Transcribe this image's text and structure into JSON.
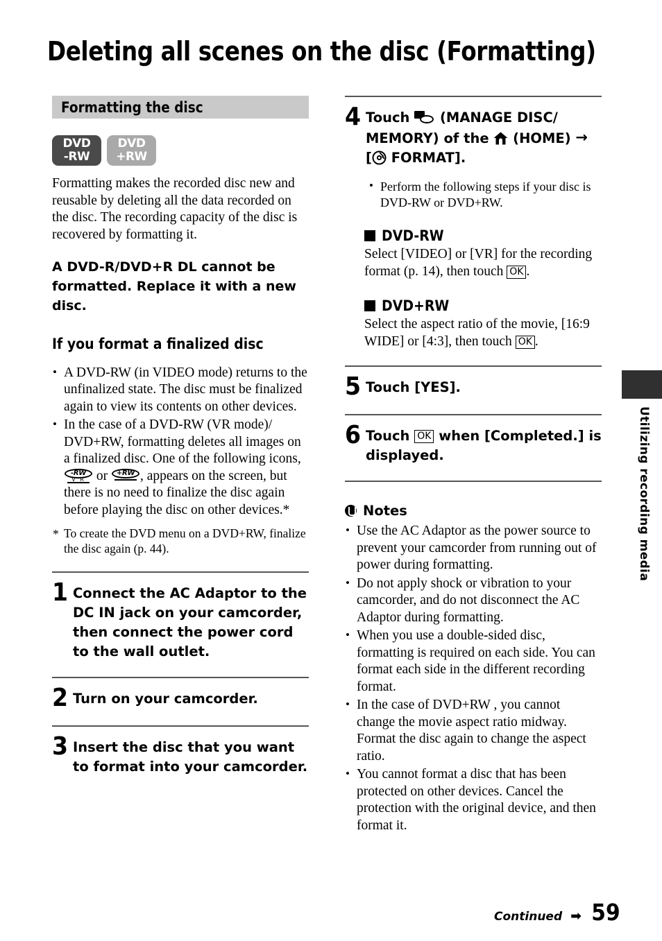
{
  "document": {
    "title": "Deleting all scenes on the disc (Formatting)",
    "page_number": "59",
    "continued_label": "Continued",
    "continued_arrow": "➡",
    "edge_tab_label": "Utilizing recording media"
  },
  "left_column": {
    "section_header": "Formatting the disc",
    "badges": [
      {
        "name": "dvd-minus-rw",
        "line1": "DVD",
        "line2": "-RW",
        "color": "#4a4a4a"
      },
      {
        "name": "dvd-plus-rw",
        "line1": "DVD",
        "line2": "+RW",
        "color": "#a9a9a9"
      }
    ],
    "intro_paragraph": "Formatting makes the recorded disc new and reusable by deleting all the data recorded on the disc. The recording capacity of the disc is recovered by formatting it.",
    "warning": "A DVD-R/DVD+R DL cannot be formatted. Replace it with a new disc.",
    "finalized_heading": "If you format a finalized disc",
    "finalized_bullets": [
      "A DVD-RW (in VIDEO mode) returns to the unfinalized state. The disc must be finalized again to view its contents on other devices.",
      {
        "part1": "In the case of a DVD-RW (VR mode)/ DVD+RW, formatting deletes all images on a finalized disc. One of the following icons, ",
        "icon1": {
          "name": "disc-rw-vr-icon",
          "oval": "-RW",
          "sub": "V R"
        },
        "mid": " or ",
        "icon2": {
          "name": "disc-plus-rw-icon",
          "oval": "+RW"
        },
        "part2": ", appears on the screen, but there is no need to finalize the disc again before playing the disc on other devices.*"
      }
    ],
    "footnote": {
      "marker": "*",
      "text": "To create the DVD menu on a DVD+RW, finalize the disc again (p. 44)."
    },
    "steps": [
      {
        "number": "1",
        "text": "Connect the AC Adaptor to the DC IN jack on your camcorder, then connect the power cord to the wall outlet."
      },
      {
        "number": "2",
        "text": "Turn on your camcorder."
      },
      {
        "number": "3",
        "text": "Insert the disc that you want to format into your camcorder."
      }
    ]
  },
  "right_column": {
    "step4": {
      "number": "4",
      "text_before_disc": "Touch ",
      "disc_icon_name": "manage-disc-memory-icon",
      "text_after_disc": " (MANAGE DISC/ MEMORY) of the ",
      "home_icon_name": "home-icon",
      "text_after_home": " (HOME) ",
      "arrow": "→",
      "bracket_open": "[",
      "format_icon_name": "format-disc-icon",
      "format_label": " FORMAT].",
      "note": "Perform the following steps if your disc is DVD-RW or DVD+RW."
    },
    "subsections": [
      {
        "heading": "DVD-RW",
        "body_before_key": "Select [VIDEO] or [VR] for the recording format (p. 14), then touch ",
        "key": "OK",
        "body_after_key": "."
      },
      {
        "heading": "DVD+RW",
        "body_before_key": "Select the aspect ratio of the movie, [16:9 WIDE] or [4:3], then touch ",
        "key": "OK",
        "body_after_key": "."
      }
    ],
    "step5": {
      "number": "5",
      "text": "Touch [YES]."
    },
    "step6": {
      "number": "6",
      "text_before_key": "Touch ",
      "key": "OK",
      "text_after_key": " when [Completed.] is displayed."
    },
    "notes": {
      "heading": "Notes",
      "icon_name": "caution-icon",
      "items": [
        "Use the AC Adaptor as the power source to prevent your camcorder from running out of power during formatting.",
        "Do not apply shock or vibration to your camcorder, and do not disconnect the AC Adaptor during formatting.",
        "When you use a double-sided disc, formatting is required on each side. You can format each side in the different recording format.",
        "In the case of DVD+RW , you cannot change the movie aspect ratio midway. Format the disc again to change the aspect ratio.",
        "You cannot format a disc that has been protected on other devices. Cancel the protection with the original device, and then format it."
      ]
    }
  }
}
